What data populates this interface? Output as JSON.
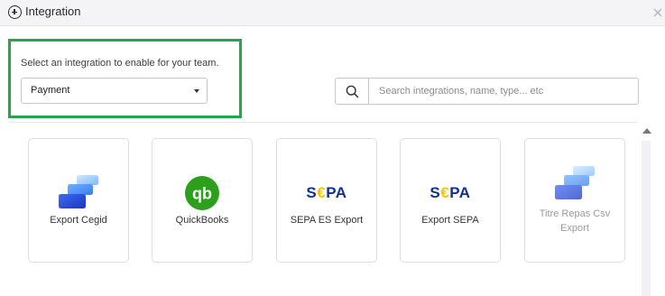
{
  "header": {
    "title": "Integration",
    "icon": "plus-circle-icon",
    "close_icon": "close-icon"
  },
  "filter": {
    "prompt": "Select an integration to enable for your team.",
    "dropdown_value": "Payment"
  },
  "search": {
    "placeholder": "Search integrations, name, type... etc"
  },
  "integrations": [
    {
      "label": "Export Cegid",
      "icon": "stacked-bars-logo-icon",
      "enabled": true
    },
    {
      "label": "QuickBooks",
      "icon": "quickbooks-logo-icon",
      "enabled": true
    },
    {
      "label": "SEPA ES Export",
      "icon": "sepa-logo-icon",
      "enabled": true
    },
    {
      "label": "Export SEPA",
      "icon": "sepa-logo-icon",
      "enabled": true
    },
    {
      "label": "Titre Repas Csv Export",
      "icon": "stacked-bars-logo-icon",
      "enabled": false
    }
  ],
  "sepa_logo": {
    "left": "S",
    "euro": "€",
    "right": "PA"
  },
  "quickbooks_logo": {
    "text": "qb"
  },
  "colors": {
    "highlight_border": "#22a84a",
    "sepa_blue": "#10318f",
    "sepa_yellow": "#f5c400",
    "quickbooks_green": "#2ca01c",
    "cegid_blue": "#2b4fd6"
  }
}
